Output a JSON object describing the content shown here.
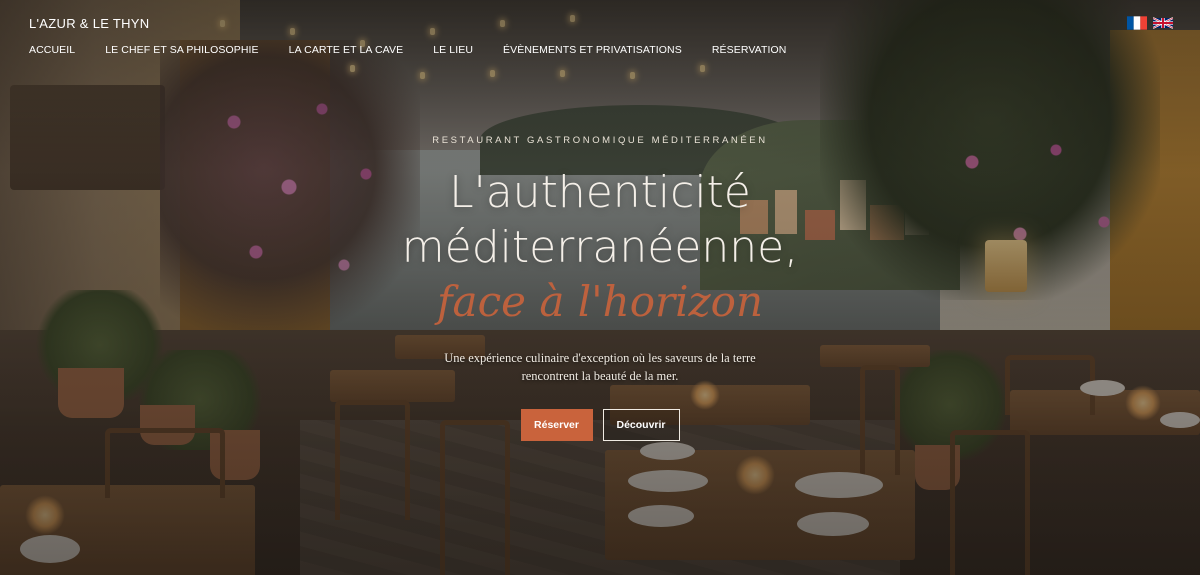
{
  "brand": {
    "name": "L'AZUR & LE THYN"
  },
  "nav": {
    "items": [
      {
        "label": "ACCUEIL"
      },
      {
        "label": "LE CHEF ET SA PHILOSOPHIE"
      },
      {
        "label": "LA CARTE ET LA CAVE"
      },
      {
        "label": "LE LIEU"
      },
      {
        "label": "ÉVÈNEMENTS ET PRIVATISATIONS"
      },
      {
        "label": "RÉSERVATION"
      }
    ]
  },
  "languages": [
    {
      "code": "fr",
      "icon": "french-flag-icon"
    },
    {
      "code": "en",
      "icon": "uk-flag-icon"
    }
  ],
  "hero": {
    "eyebrow": "RESTAURANT GASTRONOMIQUE MÉDITERRANÉEN",
    "headline_line1": "L'authenticité",
    "headline_line2": "méditerranéenne,",
    "accent_line": "face à l'horizon",
    "lead_line1": "Une expérience culinaire d'exception où les saveurs de la terre",
    "lead_line2": "rencontrent la beauté de la mer.",
    "primary_button": "Réserver",
    "secondary_button": "Découvrir"
  },
  "colors": {
    "accent": "#c9633c",
    "text": "#ffffff",
    "overlay": "#14100c"
  }
}
